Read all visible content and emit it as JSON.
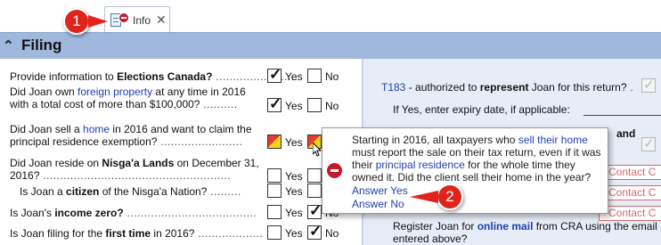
{
  "tab": {
    "label": "Info",
    "close": "✕"
  },
  "section": {
    "title": "Filing"
  },
  "left": {
    "q1": {
      "pre": "Provide information to ",
      "bold": "Elections Canada?",
      "dots": " ........................",
      "yes": "Yes",
      "no": "No"
    },
    "q2": {
      "pre": "Did Joan own ",
      "link": "foreign property",
      "post": " at any time in 2016",
      "line2": "with a total cost of more than $100,000?",
      "dots": " ..........",
      "yes": "Yes",
      "no": "No"
    },
    "q3": {
      "pre": "Did Joan sell a ",
      "link": "home",
      "post": " in 2016 and want to claim the",
      "line2": "principal residence exemption?",
      "dots": " ........................",
      "yes": "Yes"
    },
    "q4": {
      "pre": "Did Joan reside on ",
      "bold": "Nisga'a Lands",
      "post": " on December 31,",
      "line2": "2016?",
      "dots": " .......................................................",
      "yes": "Yes"
    },
    "q5": {
      "pre": "Is Joan a ",
      "bold": "citizen",
      "post": " of the Nisga'a Nation?",
      "dots": " .........",
      "yes": "Yes"
    },
    "q6": {
      "pre": "Is Joan's ",
      "bold": "income zero?",
      "dots": " ......................................",
      "yes": "Yes",
      "no": "No"
    },
    "q7": {
      "pre": "Is Joan filing for the ",
      "bold": "first time",
      "post": " in 2016?",
      "dots": " ...................",
      "yes": "Yes",
      "no": "No"
    }
  },
  "right": {
    "t183": {
      "link": "T183",
      "pre": " - authorized to ",
      "bold": "represent",
      "post": " Joan for this return?",
      "dots": " ."
    },
    "expiry": "If Yes, enter expiry date, if applicable:",
    "and_link": "and",
    "contact_label": "Contact C",
    "online_mail": {
      "pre": "Register Joan for ",
      "link": "online mail",
      "post": " from CRA using the email",
      "line2": "entered above?"
    }
  },
  "popup": {
    "message_parts": {
      "a": "Starting in 2016, all taxpayers who ",
      "link1": "sell their home",
      "b": " must report the sale on their tax return, even if it was their ",
      "link2": "principal residence",
      "c": " for the whole time they owned it. Did the client sell their home in the year?"
    },
    "answer_yes": "Answer Yes",
    "answer_no": "Answer No"
  },
  "callouts": {
    "one": "1",
    "two": "2"
  },
  "colors": {
    "header": "#9fb8dc",
    "link": "#1f3fb0",
    "badge": "#e0241c",
    "right_pane": "#e7edf7"
  }
}
